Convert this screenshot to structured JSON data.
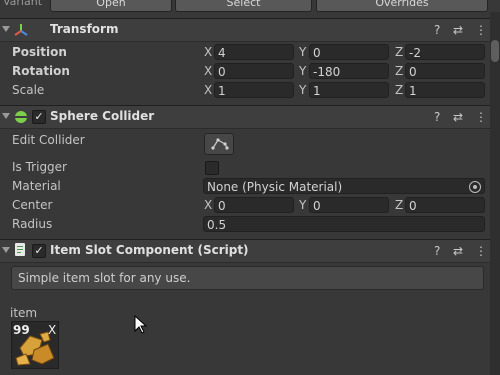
{
  "topbar": {
    "variant_label": "Variant",
    "open_label": "Open",
    "select_label": "Select",
    "overrides_label": "Overrides"
  },
  "transform": {
    "title": "Transform",
    "position": {
      "label": "Position",
      "x": "4",
      "y": "0",
      "z": "-2"
    },
    "rotation": {
      "label": "Rotation",
      "x": "0",
      "y": "-180",
      "z": "0"
    },
    "scale": {
      "label": "Scale",
      "x": "1",
      "y": "1",
      "z": "1"
    }
  },
  "axes": {
    "x": "X",
    "y": "Y",
    "z": "Z"
  },
  "sphere_collider": {
    "title": "Sphere Collider",
    "edit_collider_label": "Edit Collider",
    "is_trigger_label": "Is Trigger",
    "material_label": "Material",
    "material_value": "None (Physic Material)",
    "center_label": "Center",
    "center": {
      "x": "0",
      "y": "0",
      "z": "0"
    },
    "radius_label": "Radius",
    "radius_value": "0.5"
  },
  "item_slot": {
    "title": "Item Slot Component (Script)",
    "description": "Simple item slot for any use.",
    "item_label": "item",
    "item_count": "99",
    "item_remove": "X"
  },
  "icons": {
    "help": "?",
    "presets": "⇄",
    "menu": "⋮"
  },
  "colors": {
    "panel_bg": "#383838",
    "header_bg": "#3e3e3e",
    "field_bg": "#2a2a2a",
    "sphere_icon": "#7ccf4a"
  }
}
